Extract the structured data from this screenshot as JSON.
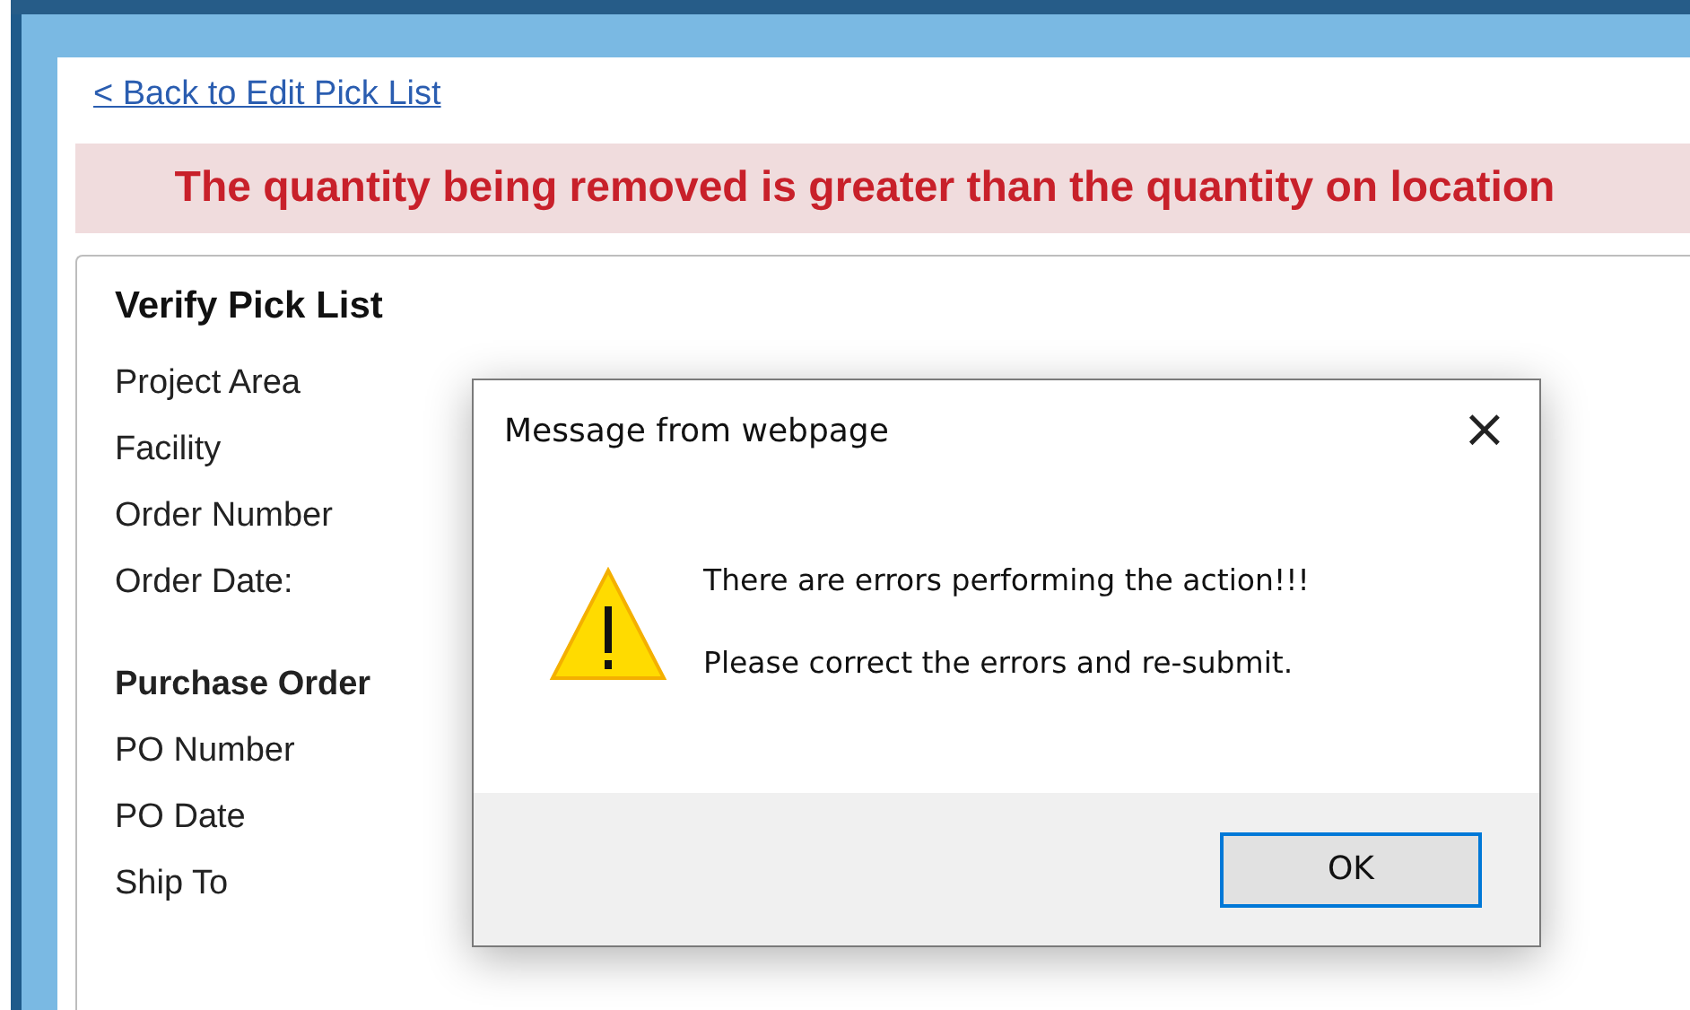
{
  "back_link": "< Back to Edit Pick List",
  "error_banner": "The quantity being removed is greater than the quantity on location",
  "panel": {
    "title": "Verify Pick List",
    "fields": [
      {
        "kind": "label",
        "text": "Project Area"
      },
      {
        "kind": "label",
        "text": "Facility"
      },
      {
        "kind": "label",
        "text": "Order Number"
      },
      {
        "kind": "label",
        "text": "Order Date:"
      },
      {
        "kind": "heading",
        "text": "Purchase Order"
      },
      {
        "kind": "label",
        "text": "PO Number"
      },
      {
        "kind": "label",
        "text": "PO Date"
      },
      {
        "kind": "label",
        "text": "Ship To"
      }
    ]
  },
  "dialog": {
    "title": "Message from webpage",
    "close": "×",
    "messages": [
      "There are errors performing the action!!!",
      "Please correct the errors and re-submit."
    ],
    "buttons": [
      "OK"
    ]
  }
}
